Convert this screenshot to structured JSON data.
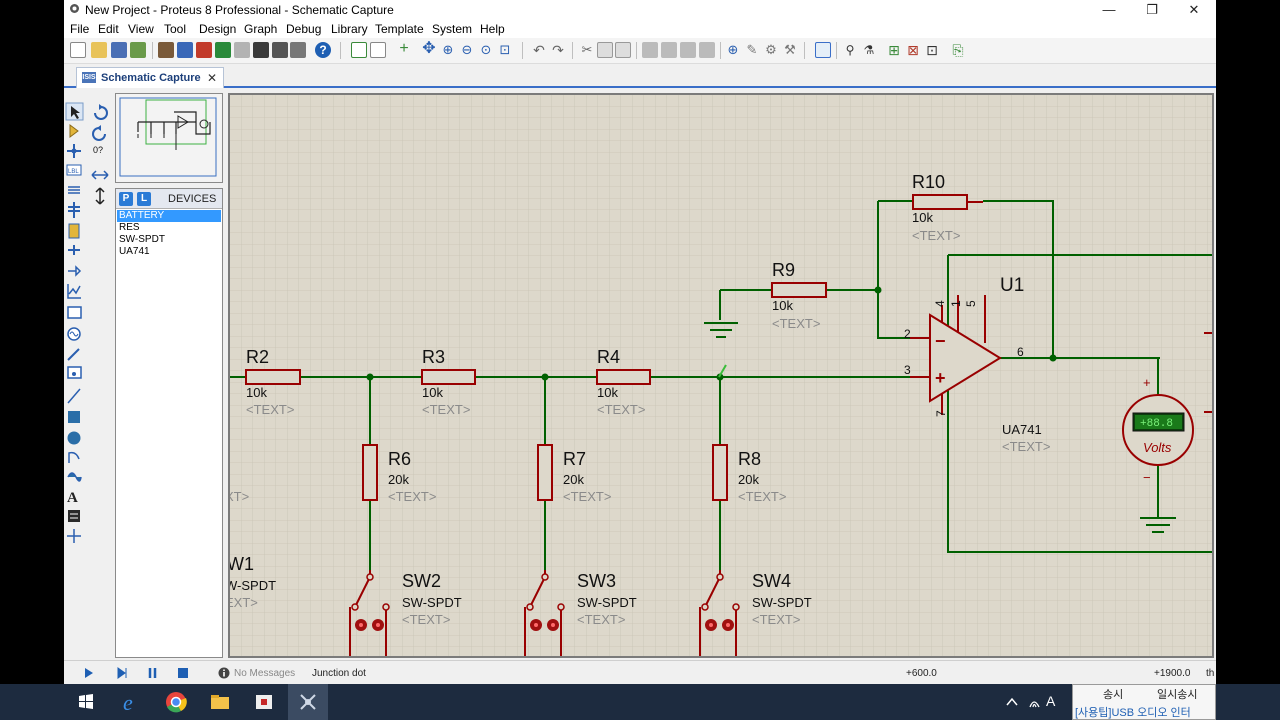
{
  "window": {
    "title": "New Project - Proteus 8 Professional - Schematic Capture",
    "minimize": "—",
    "restore": "❐",
    "close": "✕"
  },
  "menu": [
    "File",
    "Edit",
    "View",
    "Tool",
    "Design",
    "Graph",
    "Debug",
    "Library",
    "Template",
    "System",
    "Help"
  ],
  "tab": {
    "label": "Schematic Capture",
    "close": "✕",
    "icon_text": "ISIS"
  },
  "rotation_field": "0?",
  "device_panel": {
    "p_button": "P",
    "l_button": "L",
    "title": "DEVICES",
    "items": [
      "BATTERY",
      "RES",
      "SW-SPDT",
      "UA741"
    ],
    "selected": "BATTERY"
  },
  "schematic": {
    "text_placeholder": "<TEXT>",
    "resistors": [
      {
        "ref": "R2",
        "value": "10k"
      },
      {
        "ref": "R3",
        "value": "10k"
      },
      {
        "ref": "R4",
        "value": "10k"
      },
      {
        "ref": "R6",
        "value": "20k"
      },
      {
        "ref": "R7",
        "value": "20k"
      },
      {
        "ref": "R8",
        "value": "20k"
      },
      {
        "ref": "R9",
        "value": "10k"
      },
      {
        "ref": "R10",
        "value": "10k"
      }
    ],
    "switches": [
      {
        "ref": "W1",
        "type": "W-SPDT",
        "text": "EXT>"
      },
      {
        "ref": "SW2",
        "type": "SW-SPDT"
      },
      {
        "ref": "SW3",
        "type": "SW-SPDT"
      },
      {
        "ref": "SW4",
        "type": "SW-SPDT"
      }
    ],
    "left_clip_text": "XT>",
    "opamp": {
      "ref": "U1",
      "part": "UA741",
      "pins": {
        "p2": "2",
        "p3": "3",
        "p4": "4",
        "p1": "1",
        "p5": "5",
        "p6": "6",
        "p7": "7"
      },
      "minus": "−",
      "plus": "+"
    },
    "voltmeter": {
      "reading": "+88.8",
      "label": "Volts",
      "plus": "+",
      "minus": "−"
    }
  },
  "status": {
    "messages": "No Messages",
    "hint": "Junction dot",
    "coord_x": "+600.0",
    "coord_y": "+1900.0",
    "unit": "th"
  },
  "ime": {
    "line1_a": "송시",
    "line1_b": "일시송시",
    "line2": "[사용팁]USB 오디오 인터"
  },
  "taskbar": {
    "ime_indicator": "A"
  },
  "colors": {
    "wire": "#006000",
    "part": "#990000",
    "label": "#111111",
    "placeholder": "#888888",
    "grid_bg": "#ddd8cb",
    "grid_line": "#cbc6b8",
    "selection": "#3399ff"
  }
}
